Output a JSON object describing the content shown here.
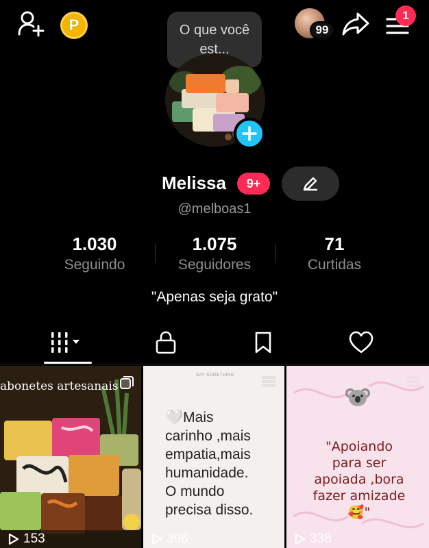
{
  "header": {
    "coin_letter": "P",
    "tooltip_text": "O que você est...",
    "friend_count": "99",
    "menu_badge": "1"
  },
  "profile": {
    "name": "Melissa",
    "name_badge": "9+",
    "username": "@melboas1",
    "bio": "\"Apenas seja grato\""
  },
  "stats": [
    {
      "value": "1.030",
      "label": "Seguindo"
    },
    {
      "value": "1.075",
      "label": "Seguidores"
    },
    {
      "value": "71",
      "label": "Curtidas"
    }
  ],
  "tabs": [
    {
      "icon": "grid-icon",
      "selected": true
    },
    {
      "icon": "lock-icon",
      "selected": false
    },
    {
      "icon": "bookmark-icon",
      "selected": false
    },
    {
      "icon": "heart-icon",
      "selected": false
    }
  ],
  "videos": [
    {
      "title": "abonetes artesanais",
      "views": "153"
    },
    {
      "tag": "SAY SOMETHING",
      "text_lines": [
        "🤍Mais",
        "carinho ,mais",
        "empatia,mais",
        "humanidade.",
        "O mundo",
        "precisa disso."
      ],
      "views": "396"
    },
    {
      "text_lines": [
        "\"Apoiando",
        "para ser",
        "apoiada ,bora",
        "fazer amizade",
        "🥰\""
      ],
      "views": "338"
    }
  ],
  "colors": {
    "background": "#000000",
    "accent_red": "#fe2c55",
    "accent_blue": "#20c5f5",
    "coin_gold": "#f5b400"
  }
}
